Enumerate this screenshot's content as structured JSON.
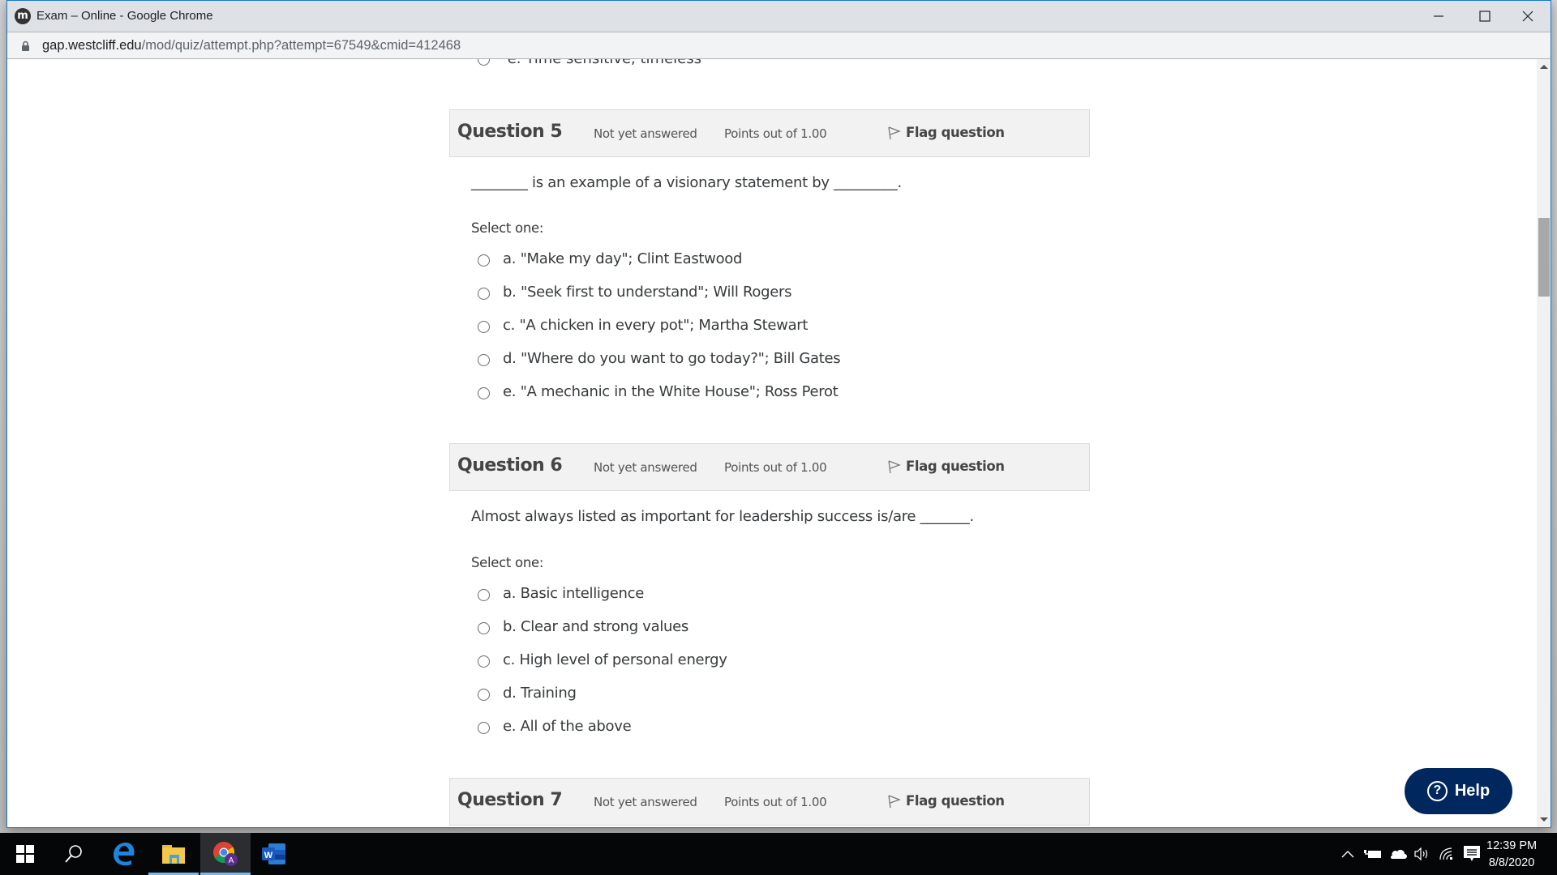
{
  "browser": {
    "window_title": "Exam – Online - Google Chrome",
    "url_domain": "gap.westcliff.edu",
    "url_path": "/mod/quiz/attempt.php?attempt=67549&cmid=412468"
  },
  "quiz": {
    "cutoff_previous_option": "e. Time sensitive, timeless",
    "questions": [
      {
        "title": "Question 5",
        "status": "Not yet answered",
        "points": "Points out of 1.00",
        "flag_label": "Flag question",
        "text": "________ is an example of a visionary statement by _________.",
        "prompt": "Select one:",
        "options": [
          "a. \"Make my day\"; Clint Eastwood",
          "b. \"Seek first to understand\"; Will Rogers",
          "c. \"A chicken in every pot\"; Martha Stewart",
          "d. \"Where do you want to go today?\"; Bill Gates",
          "e. \"A mechanic in the White House\"; Ross Perot"
        ]
      },
      {
        "title": "Question 6",
        "status": "Not yet answered",
        "points": "Points out of 1.00",
        "flag_label": "Flag question",
        "text": "Almost always listed as important for leadership success is/are _______.",
        "prompt": "Select one:",
        "options": [
          "a. Basic intelligence",
          "b. Clear and strong values",
          "c. High level of personal energy",
          "d. Training",
          "e. All of the above"
        ]
      },
      {
        "title": "Question 7",
        "status": "Not yet answered",
        "points": "Points out of 1.00",
        "flag_label": "Flag question"
      }
    ]
  },
  "help": {
    "label": "Help",
    "icon": "?"
  },
  "taskbar": {
    "apps": [
      "start-icon",
      "search-icon",
      "edge-icon",
      "file-explorer-icon",
      "chrome-icon",
      "word-icon"
    ],
    "word_letter": "W",
    "chrome_badge": "A",
    "time": "12:39 PM",
    "date": "8/8/2020"
  },
  "colors": {
    "help_bg": "#00285e",
    "window_border": "#1979ca",
    "header_bg": "#f2f2f2"
  }
}
